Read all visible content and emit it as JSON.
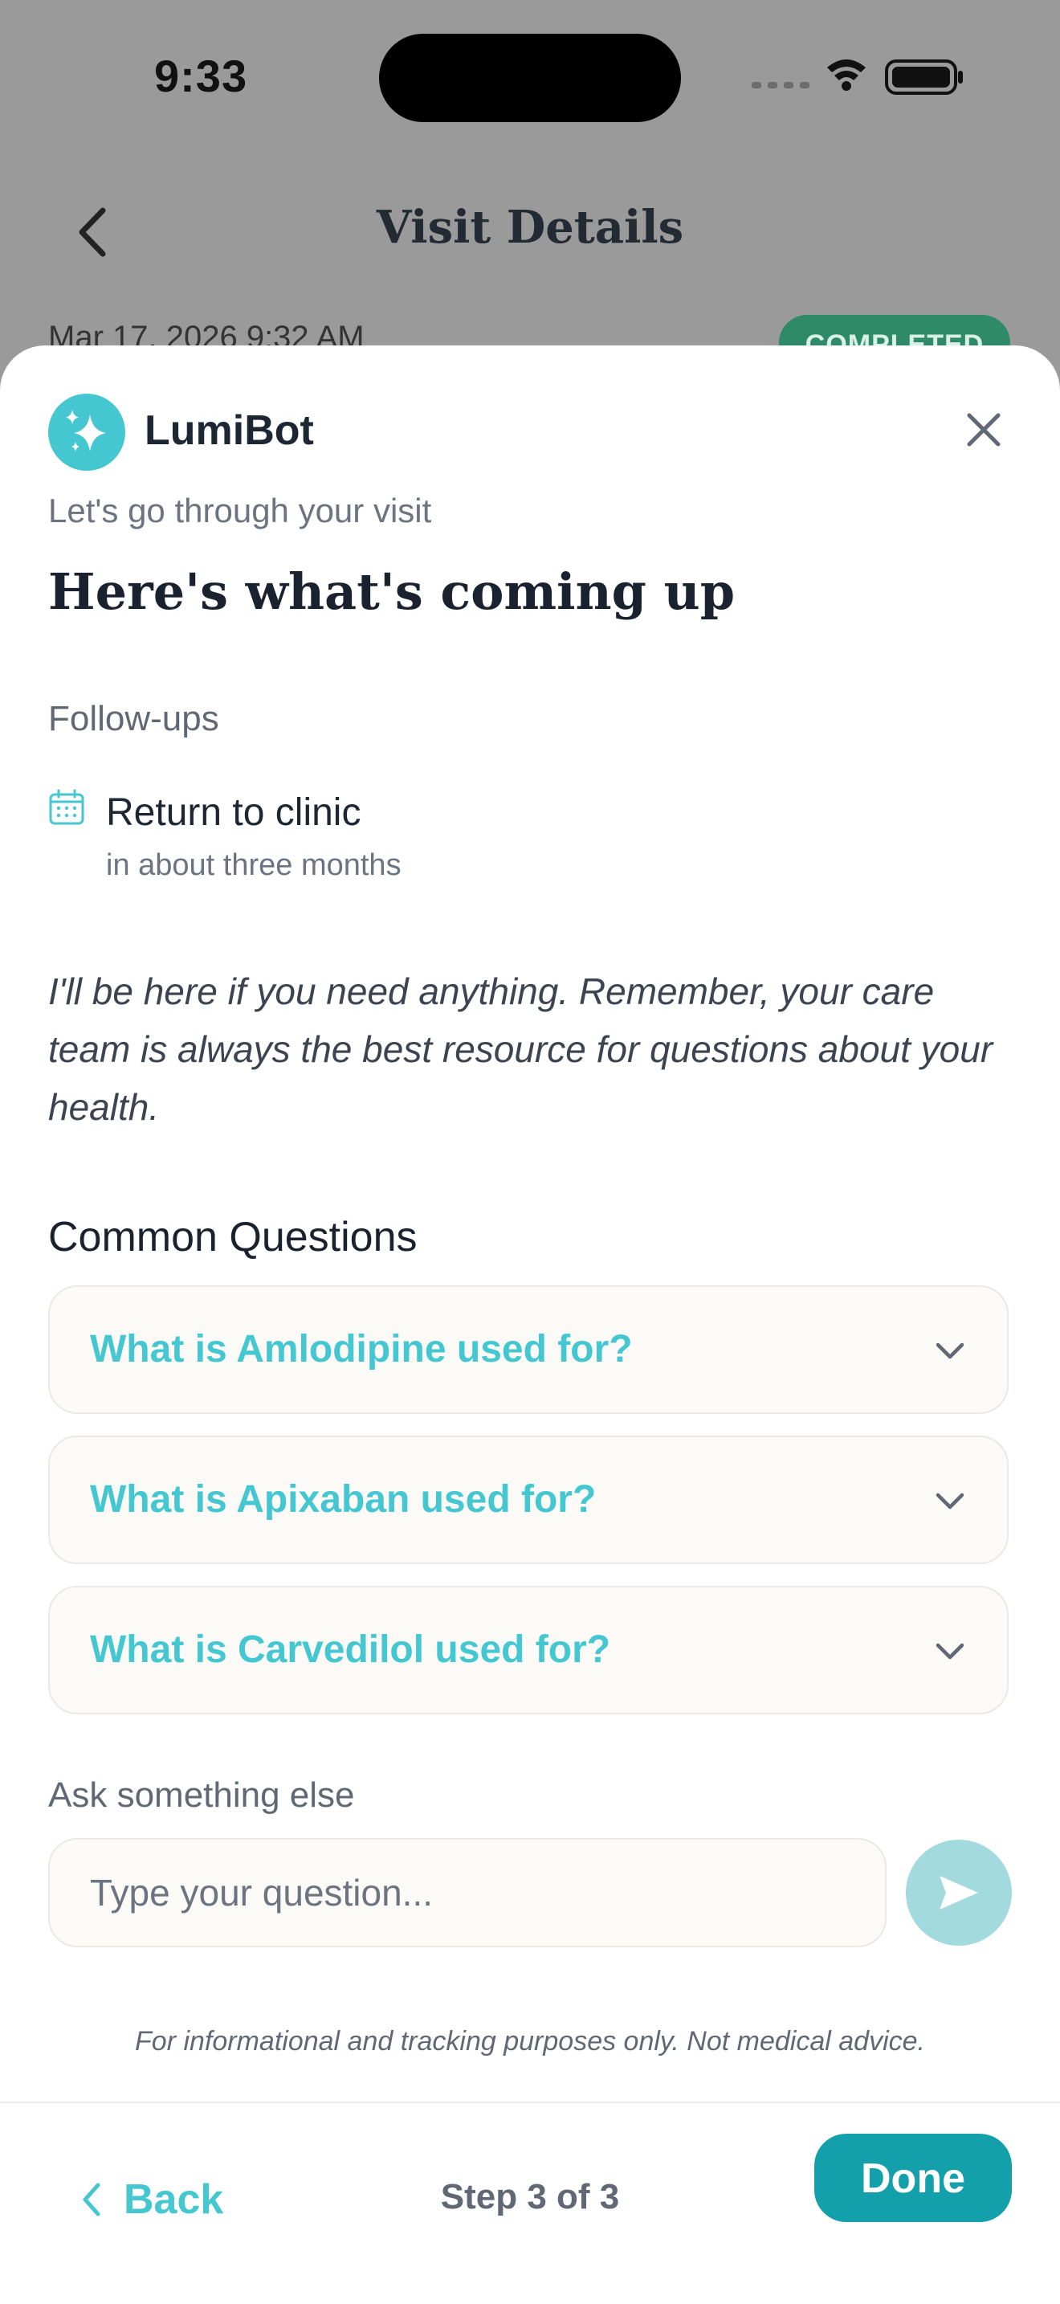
{
  "status_bar": {
    "time": "9:33"
  },
  "nav": {
    "title": "Visit Details"
  },
  "visit": {
    "date": "Mar 17, 2026 9:32 AM",
    "status_badge": "COMPLETED"
  },
  "sheet": {
    "bot_name": "LumiBot",
    "intro": "Let's go through your visit",
    "heading": "Here's what's coming up",
    "followups": {
      "label": "Follow-ups",
      "items": [
        {
          "title": "Return to clinic",
          "subtitle": "in about three months"
        }
      ]
    },
    "message": "I'll be here if you need anything. Remember, your care team is always the best resource for questions about your health.",
    "common_questions": {
      "heading": "Common Questions",
      "items": [
        {
          "label": "What is Amlodipine used for?"
        },
        {
          "label": "What is Apixaban used for?"
        },
        {
          "label": "What is Carvedilol used for?"
        }
      ]
    },
    "ask": {
      "label": "Ask something else",
      "placeholder": "Type your question..."
    },
    "disclaimer": "For informational and tracking purposes only. Not medical advice."
  },
  "footer": {
    "back_label": "Back",
    "step_text": "Step 3 of 3",
    "done_label": "Done"
  },
  "colors": {
    "accent": "#45C7D1",
    "primary_button": "#13A0AA",
    "send_button_disabled": "#A2DADD",
    "badge_green": "#2F8A6A",
    "heading_text": "#1A2230"
  },
  "icons": [
    "back-chevron-icon",
    "sparkle-icon",
    "close-icon",
    "calendar-icon",
    "chevron-down-icon",
    "send-icon",
    "wifi-icon",
    "battery-icon",
    "signal-icon"
  ]
}
